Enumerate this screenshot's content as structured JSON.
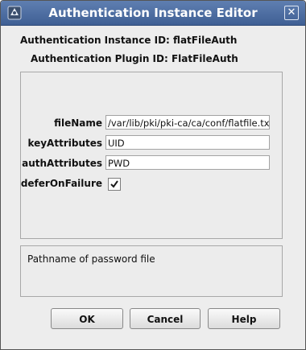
{
  "window": {
    "title": "Authentication Instance Editor"
  },
  "info": {
    "instance_id_label": "Authentication Instance ID:",
    "instance_id_value": "flatFileAuth",
    "plugin_id_label": "Authentication Plugin ID:",
    "plugin_id_value": "FlatFileAuth"
  },
  "form": {
    "fileName": {
      "label": "fileName",
      "value": "/var/lib/pki/pki-ca/ca/conf/flatfile.txt"
    },
    "keyAttributes": {
      "label": "keyAttributes",
      "value": "UID"
    },
    "authAttributes": {
      "label": "authAttributes",
      "value": "PWD"
    },
    "deferOnFailure": {
      "label": "deferOnFailure",
      "checked": true
    }
  },
  "description": {
    "text": "Pathname of password file"
  },
  "buttons": {
    "ok": "OK",
    "cancel": "Cancel",
    "help": "Help"
  }
}
